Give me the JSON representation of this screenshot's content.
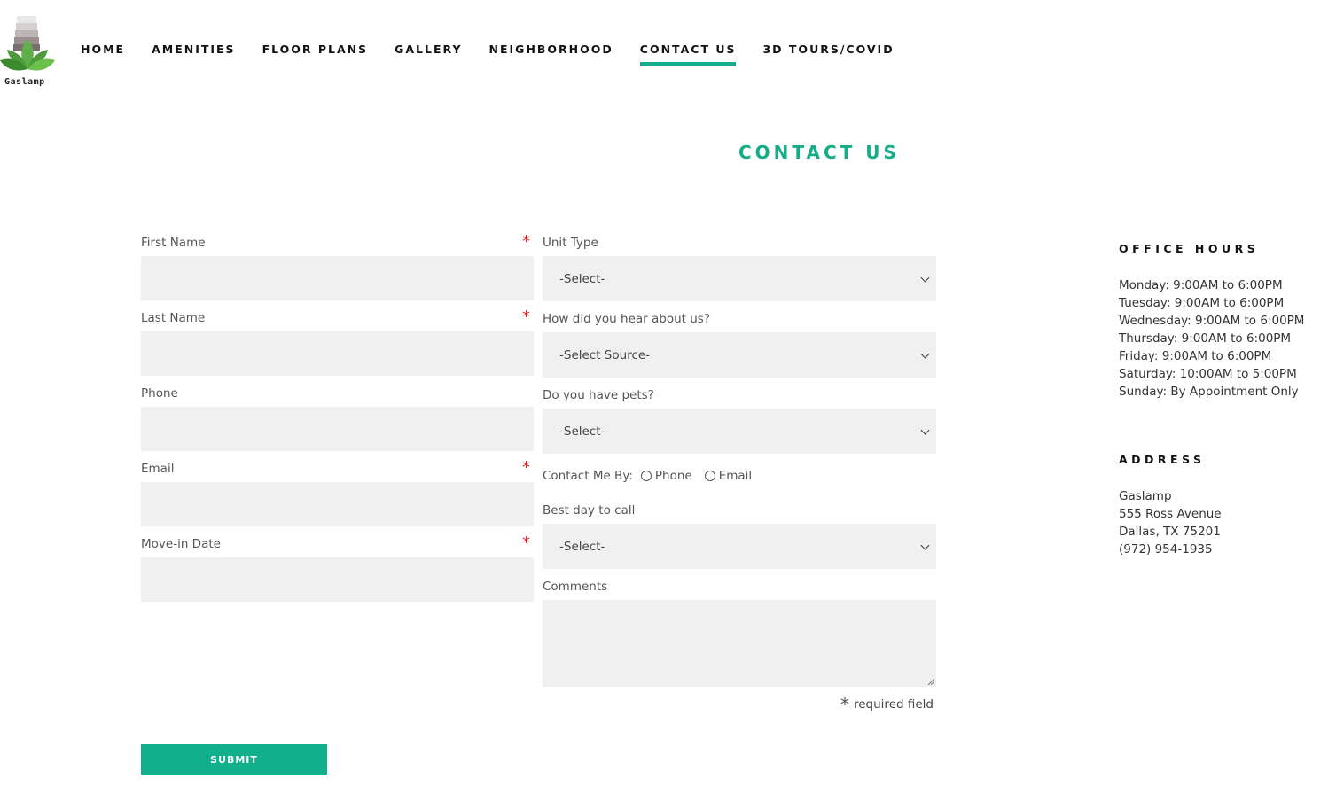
{
  "header": {
    "logo_text": "Gaslamp",
    "nav": [
      {
        "label": "HOME"
      },
      {
        "label": "AMENITIES"
      },
      {
        "label": "FLOOR PLANS"
      },
      {
        "label": "GALLERY"
      },
      {
        "label": "NEIGHBORHOOD"
      },
      {
        "label": "CONTACT US",
        "active": true
      },
      {
        "label": "3D TOURS/COVID"
      }
    ]
  },
  "page": {
    "title": "CONTACT US"
  },
  "form": {
    "first_name_label": "First Name",
    "last_name_label": "Last Name",
    "phone_label": "Phone",
    "email_label": "Email",
    "move_in_label": "Move-in Date",
    "required_mark": "*",
    "unit_type_label": "Unit Type",
    "unit_type_value": "-Select-",
    "hear_label": "How did you hear about us?",
    "hear_value": "-Select Source-",
    "pets_label": "Do you have pets?",
    "pets_value": "-Select-",
    "contact_by_label": "Contact Me By:",
    "contact_phone_label": "Phone",
    "contact_email_label": "Email",
    "best_day_label": "Best day to call",
    "best_day_value": "-Select-",
    "comments_label": "Comments",
    "required_note": "required field",
    "submit_label": "SUBMIT"
  },
  "sidebar": {
    "office_hours_heading": "OFFICE HOURS",
    "hours": [
      "Monday: 9:00AM to 6:00PM",
      "Tuesday: 9:00AM to 6:00PM",
      "Wednesday: 9:00AM to 6:00PM",
      "Thursday: 9:00AM to 6:00PM",
      "Friday: 9:00AM to 6:00PM",
      "Saturday: 10:00AM to 5:00PM",
      "Sunday: By Appointment Only"
    ],
    "address_heading": "ADDRESS",
    "address": [
      "Gaslamp",
      "555 Ross Avenue",
      "Dallas, TX 75201",
      "(972) 954-1935"
    ]
  },
  "colors": {
    "accent": "#10b08c",
    "input_bg": "#f0f0f0",
    "required": "#dd2222"
  },
  "icons": {
    "logo": "lotus-logo-icon",
    "select": "chevron-down-icon",
    "radio": "radio-icon",
    "resize": "resize-handle-icon"
  }
}
